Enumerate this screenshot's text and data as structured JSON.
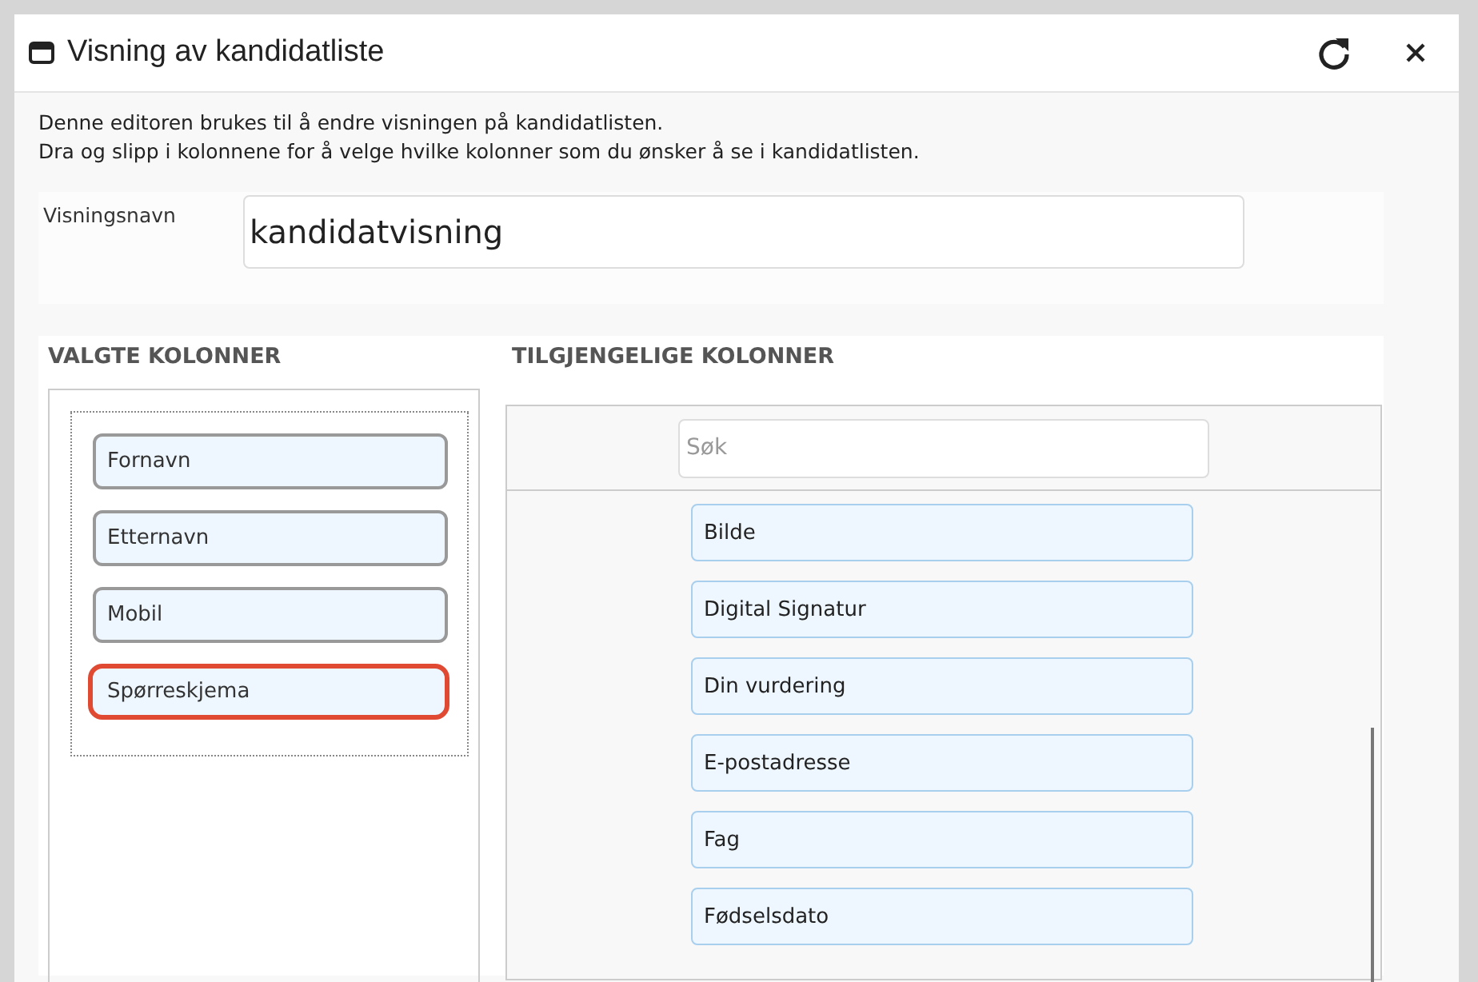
{
  "window": {
    "title": "Visning av kandidatliste"
  },
  "description": [
    "Denne editoren brukes til å endre visningen på kandidatlisten.",
    "Dra og slipp i kolonnene for å velge hvilke kolonner som du ønsker å se i kandidatlisten."
  ],
  "view_name": {
    "label": "Visningsnavn",
    "value": "kandidatvisning"
  },
  "selected_columns": {
    "heading": "VALGTE KOLONNER",
    "items": [
      {
        "label": "Fornavn",
        "highlighted": false
      },
      {
        "label": "Etternavn",
        "highlighted": false
      },
      {
        "label": "Mobil",
        "highlighted": false
      },
      {
        "label": "Spørreskjema",
        "highlighted": true
      }
    ]
  },
  "available_columns": {
    "heading": "TILGJENGELIGE KOLONNER",
    "search": {
      "placeholder": "Søk"
    },
    "items": [
      {
        "label": "Bilde"
      },
      {
        "label": "Digital Signatur"
      },
      {
        "label": "Din vurdering"
      },
      {
        "label": "E-postadresse"
      },
      {
        "label": "Fag"
      },
      {
        "label": "Fødselsdato"
      }
    ]
  }
}
